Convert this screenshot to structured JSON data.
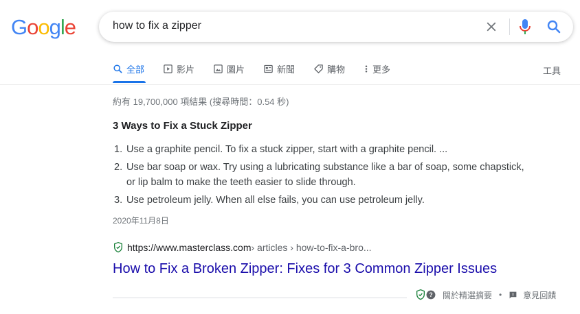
{
  "logo": {
    "letters": [
      "G",
      "o",
      "o",
      "g",
      "l",
      "e"
    ]
  },
  "colors": {
    "blue": "#4285f4",
    "red": "#ea4335",
    "yellow": "#fbbc05",
    "green": "#34a853",
    "link": "#1a0dab",
    "active_tab": "#1a73e8"
  },
  "search": {
    "query": "how to fix a zipper"
  },
  "tabs": [
    {
      "label": "全部",
      "icon": "search-icon",
      "active": true
    },
    {
      "label": "影片",
      "icon": "video-icon",
      "active": false
    },
    {
      "label": "圖片",
      "icon": "image-icon",
      "active": false
    },
    {
      "label": "新聞",
      "icon": "news-icon",
      "active": false
    },
    {
      "label": "購物",
      "icon": "tag-icon",
      "active": false
    },
    {
      "label": "更多",
      "icon": "more-icon",
      "active": false
    }
  ],
  "tools_label": "工具",
  "stats": "約有 19,700,000 項結果 (搜尋時間：0.54 秒)",
  "snippet": {
    "title": "3 Ways to Fix a Stuck Zipper",
    "items": [
      {
        "num": "1.",
        "text": "Use a graphite pencil. To fix a stuck zipper, start with a graphite pencil. ..."
      },
      {
        "num": "2.",
        "text": "Use bar soap or wax. Try using a lubricating substance like a bar of soap, some chapstick, or lip balm to make the teeth easier to slide through."
      },
      {
        "num": "3.",
        "text": "Use petroleum jelly. When all else fails, you can use petroleum jelly."
      }
    ],
    "date": "2020年11月8日"
  },
  "result": {
    "url": "https://www.masterclass.com",
    "breadcrumbs": " › articles › how-to-fix-a-bro...",
    "title": "How to Fix a Broken Zipper: Fixes for 3 Common Zipper Issues"
  },
  "footer": {
    "about": "關於精選摘要",
    "separator": "•",
    "feedback": "意見回饋"
  }
}
